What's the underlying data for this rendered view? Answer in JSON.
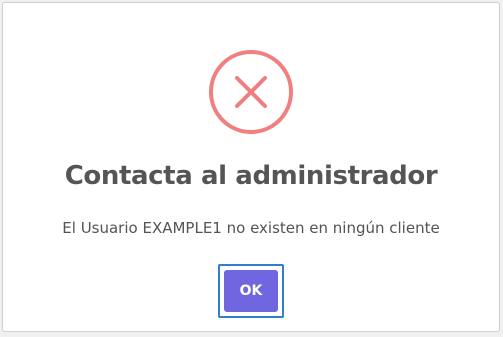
{
  "dialog": {
    "title": "Contacta al administrador",
    "message": "El Usuario EXAMPLE1 no existen en ningún cliente",
    "icon": "error-icon",
    "ok_label": "OK"
  },
  "colors": {
    "icon": "#f07f7f",
    "button": "#7066e0",
    "focus_ring": "#2f7fd0",
    "text": "#555555"
  }
}
